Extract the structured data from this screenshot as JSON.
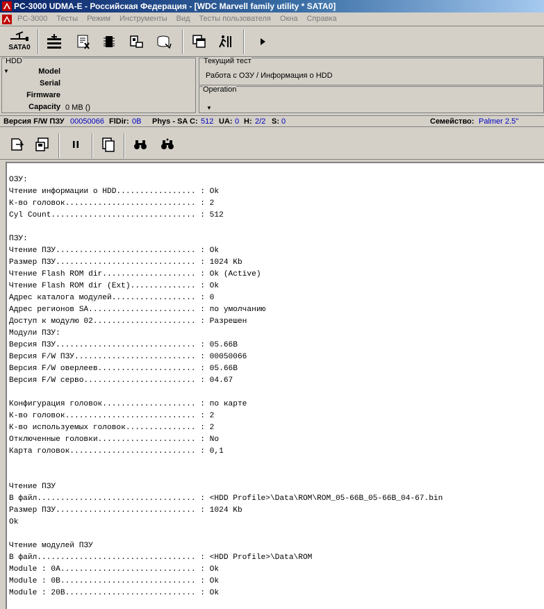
{
  "title": "PC-3000 UDMA-E - Российская Федерация - [WDC Marvell family utility * SATA0]",
  "menu": [
    "PC-3000",
    "Тесты",
    "Режим",
    "Инструменты",
    "Вид",
    "Тесты пользователя",
    "Окна",
    "Справка"
  ],
  "toolbar": {
    "sata_label": "SATA0"
  },
  "hdd_panel": {
    "caption": "HDD",
    "model_label": "Model",
    "serial_label": "Serial",
    "firmware_label": "Firmware",
    "capacity_label": "Capacity",
    "capacity_value": "0 MB ()"
  },
  "current_test": {
    "caption": "Текущий тест",
    "value": "Работа с ОЗУ / Информация о HDD"
  },
  "operation": {
    "caption": "Operation"
  },
  "status": {
    "fw_label": "Версия F/W ПЗУ",
    "fw_value": "00050066",
    "fldir_label": "FlDir:",
    "fldir_value": "0B",
    "phys_label": "Phys - SA C:",
    "phys_value": "512",
    "ua_label": "UA:",
    "ua_value": "0",
    "h_label": "H:",
    "h_value": "2/2",
    "s_label": "S:",
    "s_value": "0",
    "family_label": "Семейство:",
    "family_value": "Palmer 2.5\""
  },
  "log": [
    "ОЗУ:",
    "Чтение информации о HDD................. : Ok",
    "К-во головок............................ : 2",
    "Cyl Count............................... : 512",
    "",
    "ПЗУ:",
    "Чтение ПЗУ.............................. : Ok",
    "Размер ПЗУ.............................. : 1024 Kb",
    "Чтение Flash ROM dir.................... : Ok (Active)",
    "Чтение Flash ROM dir (Ext).............. : Ok",
    "Адрес каталога модулей.................. : 0",
    "Адрес регионов SA....................... : по умолчанию",
    "Доступ к модулю 02...................... : Разрешен",
    "Модули ПЗУ:",
    "Версия ПЗУ.............................. : 05.66B",
    "Версия F/W ПЗУ.......................... : 00050066",
    "Версия F/W оверлеев..................... : 05.66B",
    "Версия F/W серво........................ : 04.67",
    "",
    "Конфигурация головок.................... : по карте",
    "К-во головок............................ : 2",
    "К-во используемых головок............... : 2",
    "Отключенные головки..................... : No",
    "Карта головок........................... : 0,1",
    "",
    "",
    "Чтение ПЗУ",
    "В файл.................................. : <HDD Profile>\\Data\\ROM\\ROM_05-66B_05-66B_04-67.bin",
    "Размер ПЗУ.............................. : 1024 Kb",
    "Ok",
    "",
    "Чтение модулей ПЗУ",
    "В файл.................................. : <HDD Profile>\\Data\\ROM",
    "Module : 0A............................. : Ok",
    "Module : 0B............................. : Ok",
    "Module : 20B............................ : Ok"
  ]
}
